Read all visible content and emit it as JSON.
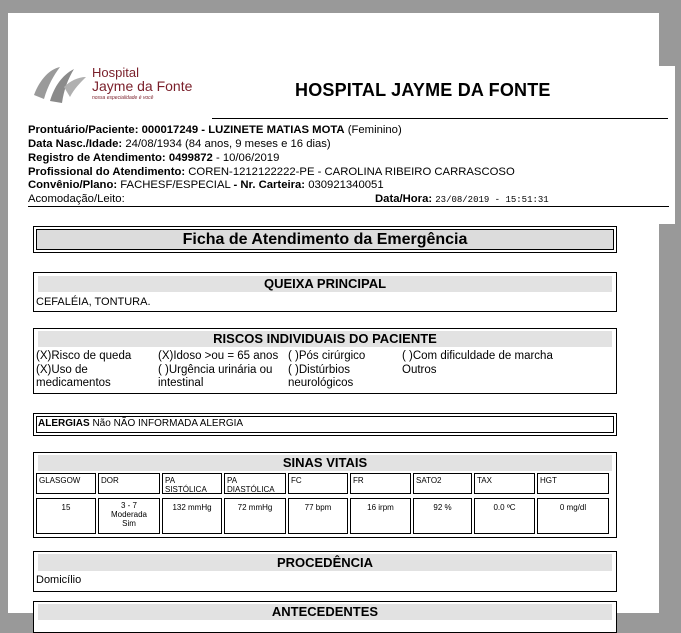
{
  "header": {
    "logo": {
      "line1": "Hospital",
      "line2": "Jayme da Fonte",
      "slogan": "nossa especialidade é você"
    },
    "hospital_title": "HOSPITAL JAYME DA FONTE"
  },
  "patient": {
    "prontuario_label": "Prontuário/Paciente:",
    "prontuario_value": "000017249 - LUZINETE MATIAS MOTA",
    "sexo": "(Feminino)",
    "nasc_label": "Data Nasc./Idade:",
    "nasc_value": "24/08/1934 (84 anos, 9 meses e 16 dias)",
    "registro_label": "Registro de Atendimento:",
    "registro_value": "0499872",
    "registro_data": "- 10/06/2019",
    "profissional_label": "Profissional do Atendimento:",
    "profissional_value": "COREN-1212122222-PE - CAROLINA RIBEIRO CARRASCOSO",
    "convenio_label": "Convênio/Plano:",
    "convenio_value": "FACHESF/ESPECIAL",
    "carteira_label": "- Nr. Carteira:",
    "carteira_value": "030921340051",
    "acomodacao_label": "Acomodação/Leito:",
    "datahora_label": "Data/Hora:",
    "datahora_value": "23/08/2019 - 15:51:31"
  },
  "ficha_title": "Ficha de Atendimento da Emergência",
  "queixa": {
    "title": "QUEIXA PRINCIPAL",
    "text": "CEFALÉIA, TONTURA."
  },
  "riscos": {
    "title": "RISCOS INDIVIDUAIS DO PACIENTE",
    "col1": [
      "(X)Risco de queda",
      "(X)Uso de",
      "medicamentos"
    ],
    "col2": [
      "(X)Idoso >ou = 65 anos",
      "( )Urgência urinária ou",
      "intestinal"
    ],
    "col3": [
      "( )Pós cirúrgico",
      "( )Distúrbios",
      "neurológicos"
    ],
    "col4": [
      "( )Com dificuldade de marcha",
      "Outros"
    ]
  },
  "alergias": {
    "label": "ALERGIAS",
    "value": "Não NÃO INFORMADA ALERGIA"
  },
  "sinais": {
    "title": "SINAS VITAIS",
    "headers": [
      [
        "GLASGOW"
      ],
      [
        "DOR"
      ],
      [
        "PA",
        "SISTÓLICA"
      ],
      [
        "PA",
        "DIASTÓLICA"
      ],
      [
        "FC"
      ],
      [
        "FR"
      ],
      [
        "SATO2"
      ],
      [
        "TAX"
      ],
      [
        "HGT"
      ]
    ],
    "values": [
      [
        "15"
      ],
      [
        "3 - 7",
        "Moderada",
        "Sim"
      ],
      [
        "132 mmHg"
      ],
      [
        "72 mmHg"
      ],
      [
        "77 bpm"
      ],
      [
        "16 irpm"
      ],
      [
        "92 %"
      ],
      [
        "0.0 ºC"
      ],
      [
        "0 mg/dl"
      ]
    ]
  },
  "procedencia": {
    "title": "PROCEDÊNCIA",
    "text": "Domicílio"
  },
  "next_section_partial": "ANTECEDENTES"
}
